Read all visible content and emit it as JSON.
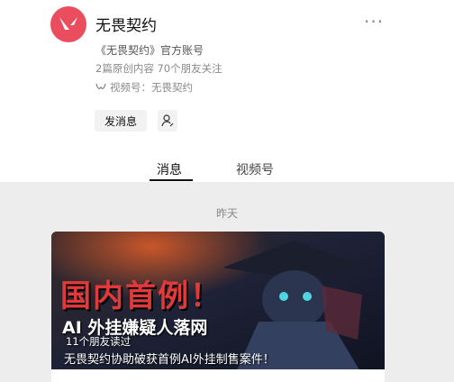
{
  "account": {
    "name": "无畏契约",
    "description": "《无畏契约》官方账号",
    "stats": "2篇原创内容  70个朋友关注",
    "channel_label": "视频号：无畏契约"
  },
  "actions": {
    "send_message": "发消息"
  },
  "tabs": [
    {
      "label": "消息",
      "active": true
    },
    {
      "label": "视频号",
      "active": false
    }
  ],
  "feed": {
    "date_label": "昨天",
    "article": {
      "cover_headline": "国内首例！",
      "cover_subline": "AI 外挂嫌疑人落网",
      "readers": "11个朋友读过",
      "title": "无畏契约协助破获首例AI外挂制售案件！"
    }
  },
  "colors": {
    "brand": "#ea4d5d",
    "headline_red": "#e23a3a"
  },
  "icons": {
    "avatar": "valorant-logo-icon",
    "more": "more-dots-icon",
    "channel": "channels-icon",
    "follow": "follow-person-icon"
  }
}
